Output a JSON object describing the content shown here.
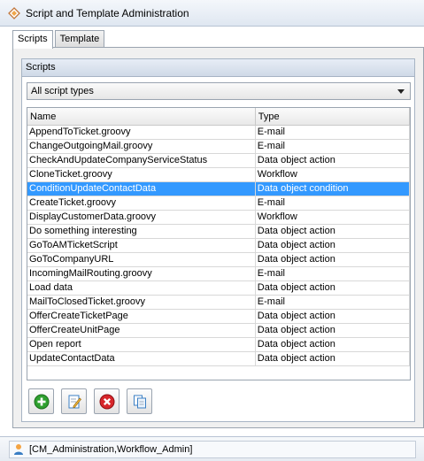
{
  "window": {
    "title": "Script and Template Administration"
  },
  "tabs": [
    {
      "label": "Scripts",
      "active": true
    },
    {
      "label": "Template",
      "active": false
    }
  ],
  "scripts_group": {
    "header": "Scripts",
    "filter": {
      "selected": "All script types"
    },
    "table": {
      "columns": [
        "Name",
        "Type"
      ],
      "rows": [
        {
          "name": "AppendToTicket.groovy",
          "type": "E-mail"
        },
        {
          "name": "ChangeOutgoingMail.groovy",
          "type": "E-mail"
        },
        {
          "name": "CheckAndUpdateCompanyServiceStatus",
          "type": "Data object action"
        },
        {
          "name": "CloneTicket.groovy",
          "type": "Workflow"
        },
        {
          "name": "ConditionUpdateContactData",
          "type": "Data object condition",
          "selected": true
        },
        {
          "name": "CreateTicket.groovy",
          "type": "E-mail"
        },
        {
          "name": "DisplayCustomerData.groovy",
          "type": "Workflow"
        },
        {
          "name": "Do something interesting",
          "type": "Data object action"
        },
        {
          "name": "GoToAMTicketScript",
          "type": "Data object action"
        },
        {
          "name": "GoToCompanyURL",
          "type": "Data object action"
        },
        {
          "name": "IncomingMailRouting.groovy",
          "type": "E-mail"
        },
        {
          "name": "Load data",
          "type": "Data object action"
        },
        {
          "name": "MailToClosedTicket.groovy",
          "type": "E-mail"
        },
        {
          "name": "OfferCreateTicketPage",
          "type": "Data object action"
        },
        {
          "name": "OfferCreateUnitPage",
          "type": "Data object action"
        },
        {
          "name": "Open report",
          "type": "Data object action"
        },
        {
          "name": "UpdateContactData",
          "type": "Data object action"
        }
      ]
    },
    "toolbar": [
      "add-icon",
      "edit-icon",
      "delete-icon",
      "copy-icon"
    ]
  },
  "status": {
    "user_roles": "[CM_Administration,Workflow_Admin]"
  },
  "colors": {
    "selection": "#3399ff",
    "header_gradient": "#cfd9e7"
  }
}
